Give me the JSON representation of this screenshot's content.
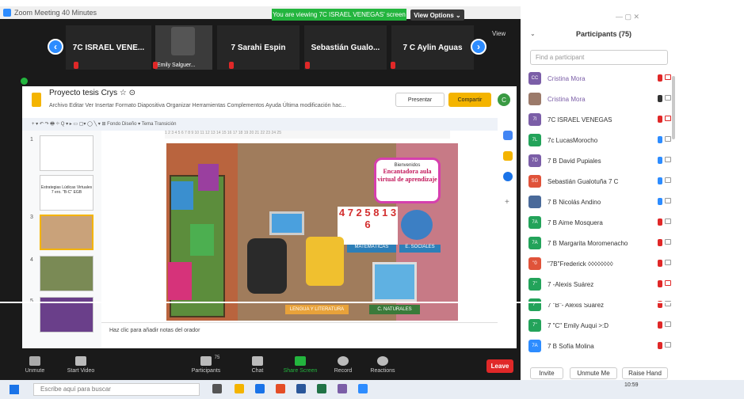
{
  "window": {
    "title": "Zoom Meeting 40 Minutes",
    "viewing_banner": "You are viewing 7C ISRAEL VENEGAS' screen",
    "view_options": "View Options ⌄",
    "view": "View"
  },
  "gallery": [
    {
      "name": "7C ISRAEL VENE..."
    },
    {
      "name": "Emily Salguer..."
    },
    {
      "name": "7   Sarahi Espin"
    },
    {
      "name": "Sebastián  Gualo..."
    },
    {
      "name": "7 C Aylin Aguas"
    }
  ],
  "slides": {
    "title": "Proyecto tesis Crys  ☆  ⊙",
    "menu": "Archivo  Editar  Ver  Insertar  Formato  Diapositiva  Organizar  Herramientas  Complementos  Ayuda   Última modificación hac...",
    "present": "Presentar",
    "share": "Compartir",
    "avatar": "C",
    "toolbar": "+ ▾  ↶  ↷  🖶  ⌖   Q ▾   ▸  ▭  ▢▾  ◯  ╲ ▾   ⊞   Fondo    Diseño ▾    Tema    Transición",
    "ruler": "1  2  3  4  5  6  7  8  9  10  11  12  13  14  15  16  17  18  19  20  21  22  23  24  25",
    "thumbs": [
      {
        "n": "1"
      },
      {
        "n": "",
        "text": "Estrategias Lúdicas Virtuales 7 ero. \"B-C\" EGB"
      },
      {
        "n": "3"
      },
      {
        "n": "4"
      },
      {
        "n": "5"
      }
    ],
    "slide": {
      "welcome_small": "Bienvenidos",
      "welcome_title": "Encantadora aula virtual de aprendizaje",
      "math_digits": "4 7 2 5 8 1 3 6",
      "math": "MATEMÁTICAS",
      "social": "E. SOCIALES",
      "language": "LENGUA Y LITERATURA",
      "natural": "C. NATURALES"
    },
    "notes": "Haz clic para añadir notas del orador"
  },
  "controls": {
    "unmute": "Unmute",
    "video": "Start Video",
    "participants": "Participants",
    "participants_count": "75",
    "chat": "Chat",
    "share": "Share Screen",
    "record": "Record",
    "reactions": "Reactions",
    "leave": "Leave"
  },
  "panel": {
    "window_controls": "—    ▢    ✕",
    "title": "Participants (75)",
    "search_placeholder": "Find a participant",
    "invite": "Invite",
    "unmute_me": "Unmute Me",
    "raise_hand": "Raise Hand",
    "participants": [
      {
        "initials": "CC",
        "name": "Cristina Mora",
        "color": "#7b5ea7",
        "purple": true,
        "mic": "red",
        "cam": "red"
      },
      {
        "initials": "",
        "name": "Cristina Mora",
        "color": "#9b7a6a",
        "purple": true,
        "mic": "on",
        "cam": "grey"
      },
      {
        "initials": "7I",
        "name": "7C ISRAEL VENEGAS",
        "color": "#7b5ea7",
        "purple": false,
        "mic": "red",
        "cam": "red"
      },
      {
        "initials": "7L",
        "name": "7c LucasMorocho",
        "color": "#23a35a",
        "purple": false,
        "mic": "blue",
        "cam": "grey"
      },
      {
        "initials": "7D",
        "name": "7 B David Pupiales",
        "color": "#7b5ea7",
        "purple": false,
        "mic": "blue",
        "cam": "grey"
      },
      {
        "initials": "SG",
        "name": "Sebastián Gualotuña 7 C",
        "color": "#e0533a",
        "purple": false,
        "mic": "blue",
        "cam": "grey"
      },
      {
        "initials": "",
        "name": "7 B Nicolás Andino",
        "color": "#4a6a9a",
        "purple": false,
        "mic": "blue",
        "cam": "grey"
      },
      {
        "initials": "7A",
        "name": "7 B Aime Mosquera",
        "color": "#23a35a",
        "purple": false,
        "mic": "red",
        "cam": "grey"
      },
      {
        "initials": "7A",
        "name": "7 B Margarita Moromenacho",
        "color": "#23a35a",
        "purple": false,
        "mic": "red",
        "cam": "grey"
      },
      {
        "initials": "\"0",
        "name": "\"7B\"Frederick ◊◊◊◊◊◊◊◊",
        "color": "#e0533a",
        "purple": false,
        "mic": "red",
        "cam": "grey"
      },
      {
        "initials": "7\"",
        "name": "7    -Alexis Suárez",
        "color": "#23a35a",
        "purple": false,
        "mic": "red",
        "cam": "red"
      },
      {
        "initials": "7\"",
        "name": "7 \"B\"- Alexis Suárez",
        "color": "#23a35a",
        "purple": false,
        "mic": "red",
        "cam": "grey"
      },
      {
        "initials": "7\"",
        "name": "7 \"C\" Emily Auqui >:D",
        "color": "#23a35a",
        "purple": false,
        "mic": "red",
        "cam": "grey"
      },
      {
        "initials": "7A",
        "name": "7 B  Sofía Molina",
        "color": "#2d8cff",
        "purple": false,
        "mic": "red",
        "cam": "grey"
      }
    ]
  },
  "taskbar": {
    "search": "Escribe aquí para buscar",
    "time": "10:59"
  }
}
